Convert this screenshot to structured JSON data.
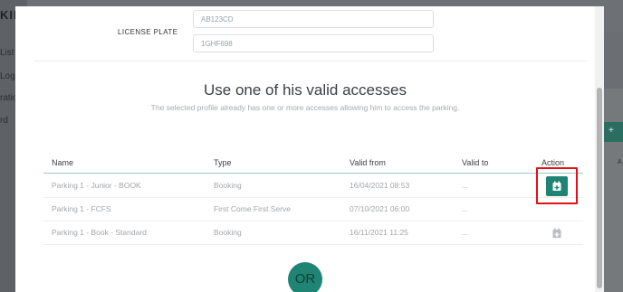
{
  "background": {
    "brand": "KING",
    "nav": [
      "List",
      "Logs",
      "ration",
      "rd"
    ],
    "right_text": "A"
  },
  "license_plate": {
    "label": "LICENSE PLATE",
    "input1_placeholder": "AB123CD",
    "input2_value": "1GHF698"
  },
  "accesses": {
    "heading": "Use one of his valid accesses",
    "subheading": "The selected profile already has one or more accesses allowing him to access the parking.",
    "columns": [
      "Name",
      "Type",
      "Valid from",
      "Valid to",
      "Action"
    ],
    "rows": [
      {
        "name": "Parking 1 - Junior - BOOK",
        "type": "Booking",
        "valid_from": "16/04/2021 08:53",
        "valid_to": "..."
      },
      {
        "name": "Parking 1 - FCFS",
        "type": "First Come First Serve",
        "valid_from": "07/10/2021 06:00",
        "valid_to": "..."
      },
      {
        "name": "Parking 1 - Book - Standard",
        "type": "Booking",
        "valid_from": "16/11/2021 11:25",
        "valid_to": "..."
      }
    ]
  },
  "or_label": "OR",
  "colors": {
    "accent": "#1f8474",
    "highlight": "#e3101a"
  },
  "icons": {
    "action": "calendar-plus-icon"
  }
}
